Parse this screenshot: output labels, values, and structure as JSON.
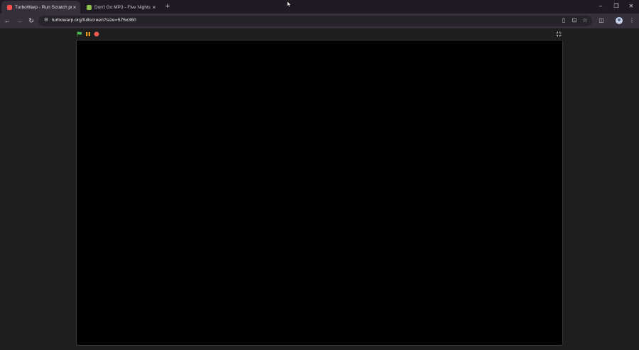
{
  "browser": {
    "tabs": [
      {
        "title": "TurboWarp - Run Scratch proje",
        "close": "×",
        "favicon_color": "#ff4c4c",
        "active": true
      },
      {
        "title": "Don't Go MP3 - Five Nights at",
        "close": "×",
        "favicon_color": "#8bc34a",
        "active": false
      }
    ],
    "new_tab": "+",
    "window_controls": {
      "minimize": "–",
      "maximize": "❐",
      "close": "✕"
    },
    "address": "turbowarp.org/fullscreen?size=575x360"
  },
  "colors": {
    "tabstrip_bg": "#1f1a24",
    "toolbar_bg": "#35303b",
    "page_bg": "#1e1e1e",
    "stage_bg": "#000000",
    "green_flag": "#4cbf56",
    "pause": "#ffab19",
    "stop": "#ec5959"
  }
}
